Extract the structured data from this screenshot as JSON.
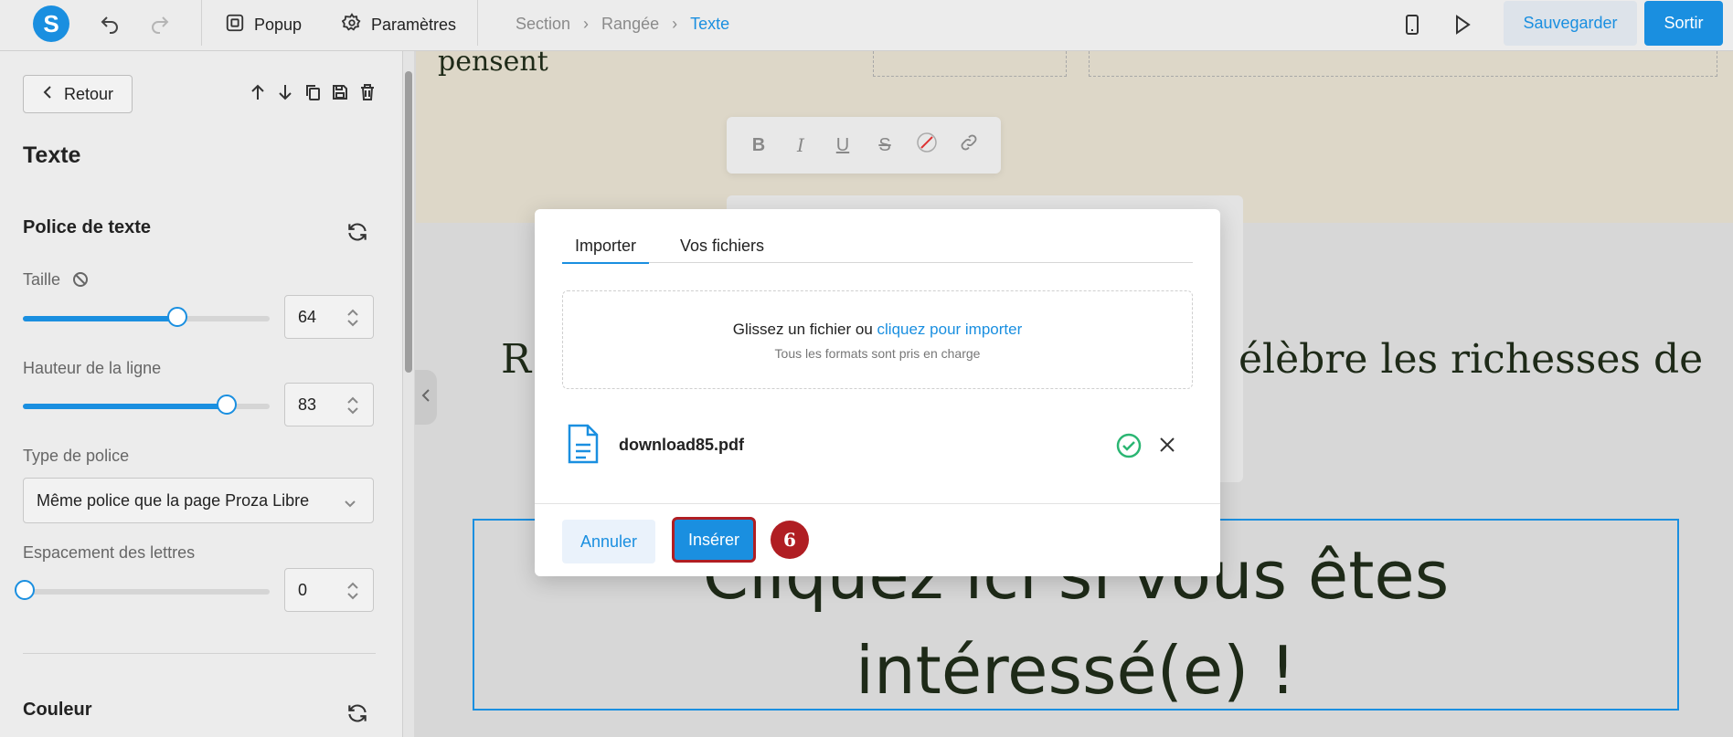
{
  "topbar": {
    "logo": "S",
    "popup_label": "Popup",
    "settings_label": "Paramètres",
    "breadcrumb": [
      "Section",
      "Rangée",
      "Texte"
    ],
    "save_label": "Sauvegarder",
    "exit_label": "Sortir"
  },
  "sidebar": {
    "back_label": "Retour",
    "title": "Texte",
    "font_section": "Police de texte",
    "size_label": "Taille",
    "size_value": "64",
    "size_slider": 0.62,
    "line_height_label": "Hauteur de la ligne",
    "line_height_value": "83",
    "line_height_slider": 0.82,
    "font_type_label": "Type de police",
    "font_type_value": "Même police que la page Proza Libre",
    "letter_spacing_label": "Espacement des lettres",
    "letter_spacing_value": "0",
    "letter_spacing_slider": 0.0,
    "color_section": "Couleur"
  },
  "canvas": {
    "hero_text": "pensent",
    "heading_left": "R",
    "heading_right": "élèbre les richesses de",
    "big_text_line1": "Cliquez ici si vous êtes",
    "big_text_line2": "intéressé(e) !"
  },
  "modal": {
    "tab_import": "Importer",
    "tab_files": "Vos fichiers",
    "drop_text": "Glissez un fichier ou ",
    "drop_link": "cliquez pour importer",
    "drop_sub": "Tous les formats sont pris en charge",
    "file_name": "download85.pdf",
    "cancel_label": "Annuler",
    "insert_label": "Insérer",
    "step_number": "6"
  },
  "colors": {
    "accent": "#1a8fe0",
    "step_badge": "#b01e23",
    "success": "#2bb673"
  }
}
